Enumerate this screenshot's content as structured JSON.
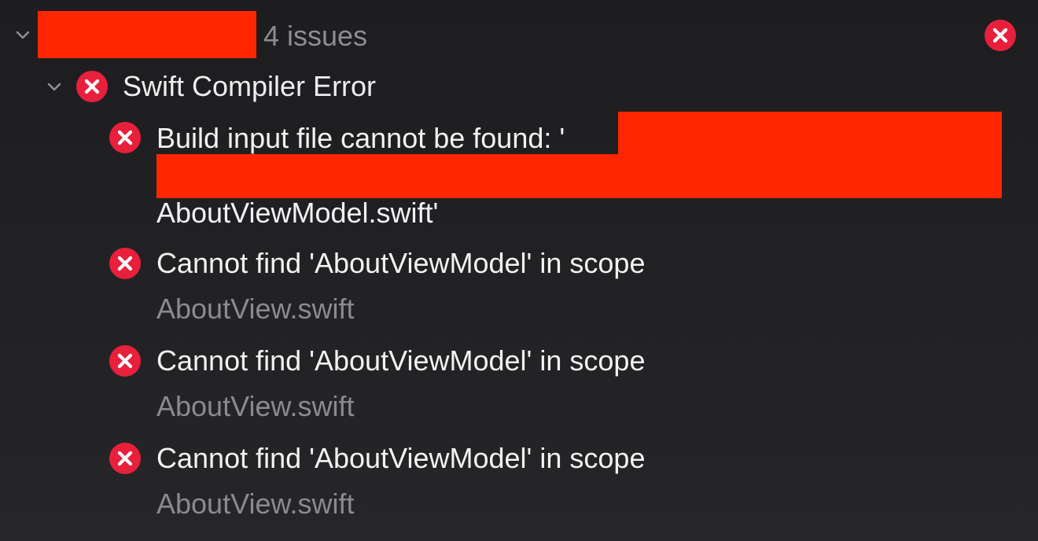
{
  "group": {
    "issue_count": "4 issues",
    "expanded_icon": "chevron-down-icon",
    "status_icon": "error-icon"
  },
  "category": {
    "title": "Swift Compiler Error",
    "icon": "error-icon"
  },
  "issues": [
    {
      "message": "Build input file cannot be found: '",
      "message_cont": "AboutViewModel.swift'",
      "icon": "error-icon"
    },
    {
      "message": "Cannot find 'AboutViewModel' in scope",
      "file": "AboutView.swift",
      "icon": "error-icon"
    },
    {
      "message": "Cannot find 'AboutViewModel' in scope",
      "file": "AboutView.swift",
      "icon": "error-icon"
    },
    {
      "message": "Cannot find 'AboutViewModel' in scope",
      "file": "AboutView.swift",
      "icon": "error-icon"
    }
  ],
  "colors": {
    "error_red": "#e8203c",
    "redaction": "#ff2600",
    "background": "#202023"
  }
}
